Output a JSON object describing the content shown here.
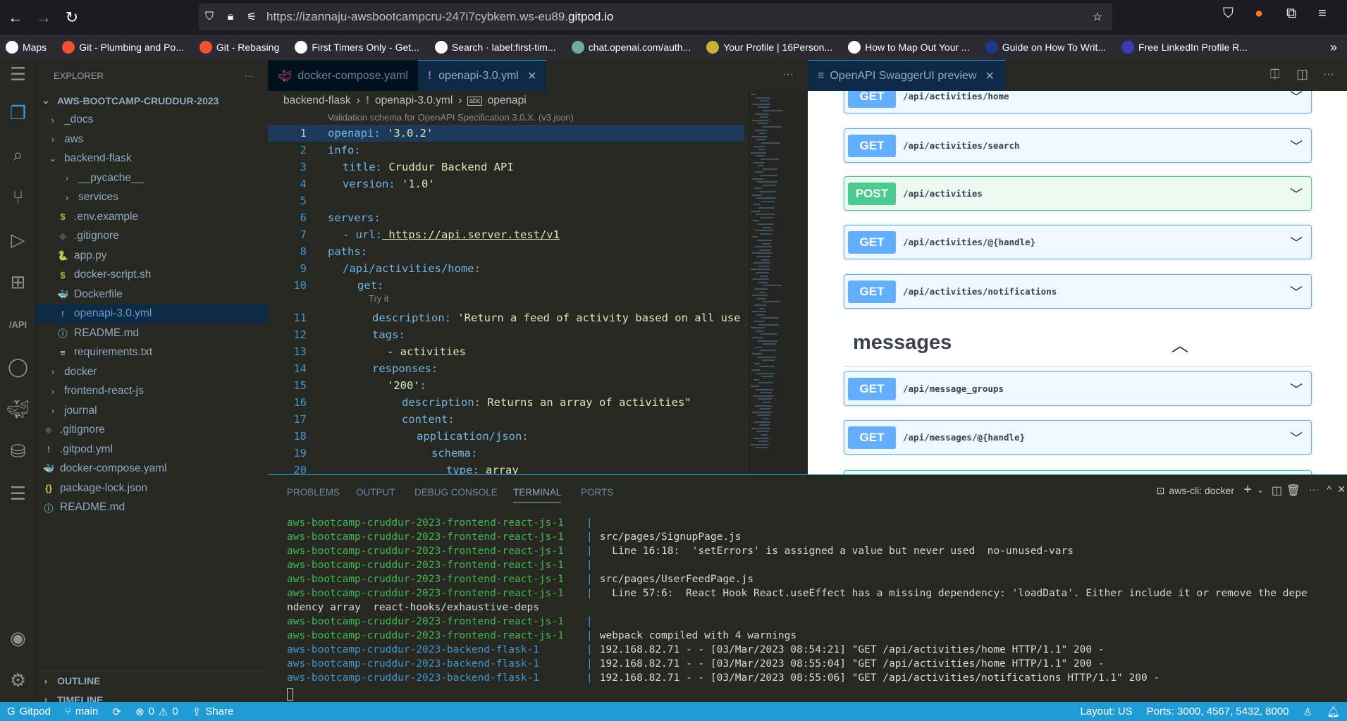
{
  "browser": {
    "url_prefix": "https://izannaju-awsbootcampcru-247i7cybkem.ws-eu89.",
    "url_domain": "gitpod.io",
    "bookmarks": [
      {
        "label": "Maps",
        "color": "#fbfbfe"
      },
      {
        "label": "Git - Plumbing and Po...",
        "color": "#f05133"
      },
      {
        "label": "Git - Rebasing",
        "color": "#f05133"
      },
      {
        "label": "First Timers Only - Get...",
        "color": "#fbfbfe"
      },
      {
        "label": "Search · label:first-tim...",
        "color": "#fbfbfe"
      },
      {
        "label": "chat.openai.com/auth...",
        "color": "#74aa9c"
      },
      {
        "label": "Your Profile | 16Person...",
        "color": "#c9b037"
      },
      {
        "label": "How to Map Out Your ...",
        "color": "#fbfbfe"
      },
      {
        "label": "Guide on How To Writ...",
        "color": "#1a3a8a"
      },
      {
        "label": "Free LinkedIn Profile R...",
        "color": "#3b3bb5"
      }
    ]
  },
  "sidebar": {
    "title": "EXPLORER",
    "root": "AWS-BOOTCAMP-CRUDDUR-2023",
    "items": [
      {
        "label": "_docs",
        "type": "folder",
        "depth": 1
      },
      {
        "label": "aws",
        "type": "folder",
        "depth": 1
      },
      {
        "label": "backend-flask",
        "type": "folder-open",
        "depth": 1
      },
      {
        "label": "__pycache__",
        "type": "folder",
        "depth": 2
      },
      {
        "label": "services",
        "type": "folder",
        "depth": 2
      },
      {
        "label": ".env.example",
        "type": "file",
        "icon": "$",
        "iconColor": "#8dc149",
        "depth": 2
      },
      {
        "label": ".gitignore",
        "type": "file",
        "icon": "◆",
        "iconColor": "#41535b",
        "depth": 2
      },
      {
        "label": "app.py",
        "type": "file",
        "icon": "🐍",
        "iconColor": "#3e97d1",
        "depth": 2
      },
      {
        "label": "docker-script.sh",
        "type": "file",
        "icon": "$",
        "iconColor": "#8dc149",
        "depth": 2
      },
      {
        "label": "Dockerfile",
        "type": "file",
        "icon": "🐳",
        "iconColor": "#3e97d1",
        "depth": 2
      },
      {
        "label": "openapi-3.0.yml",
        "type": "file",
        "icon": "!",
        "iconColor": "#a074c4",
        "depth": 2,
        "selected": true
      },
      {
        "label": "README.md",
        "type": "file",
        "icon": "ⓘ",
        "iconColor": "#519aba",
        "depth": 2
      },
      {
        "label": "requirements.txt",
        "type": "file",
        "icon": "≡",
        "iconColor": "#d4d7d6",
        "depth": 2
      },
      {
        "label": "docker",
        "type": "folder",
        "depth": 1
      },
      {
        "label": "frontend-react-js",
        "type": "folder",
        "depth": 1
      },
      {
        "label": "journal",
        "type": "folder",
        "depth": 1
      },
      {
        "label": ".gitignore",
        "type": "file",
        "icon": "◆",
        "iconColor": "#41535b",
        "depth": 1
      },
      {
        "label": ".gitpod.yml",
        "type": "file",
        "icon": "!",
        "iconColor": "#a074c4",
        "depth": 1
      },
      {
        "label": "docker-compose.yaml",
        "type": "file",
        "icon": "🐳",
        "iconColor": "#e0487a",
        "depth": 1
      },
      {
        "label": "package-lock.json",
        "type": "file",
        "icon": "{}",
        "iconColor": "#cbcb41",
        "depth": 1
      },
      {
        "label": "README.md",
        "type": "file",
        "icon": "ⓘ",
        "iconColor": "#519aba",
        "depth": 1
      }
    ],
    "outline": "OUTLINE",
    "timeline": "TIMELINE"
  },
  "editor": {
    "tabs": [
      {
        "label": "docker-compose.yaml",
        "active": false
      },
      {
        "label": "openapi-3.0.yml",
        "active": true
      }
    ],
    "breadcrumbs": [
      "backend-flask",
      "openapi-3.0.yml",
      "openapi"
    ],
    "codelens_schema": "Validation schema for OpenAPI Specification 3.0.X. (v3.json)",
    "codelens_try": "Try it",
    "lines": [
      {
        "n": "1",
        "key": "openapi",
        "val": " '3.0.2'",
        "indent": 0
      },
      {
        "n": "2",
        "key": "info",
        "val": "",
        "indent": 0
      },
      {
        "n": "3",
        "key": "title",
        "val": " Cruddur Backend API",
        "indent": 1
      },
      {
        "n": "4",
        "key": "version",
        "val": " '1.0'",
        "indent": 1
      },
      {
        "n": "5",
        "key": "",
        "val": "",
        "indent": 0
      },
      {
        "n": "6",
        "key": "servers",
        "val": "",
        "indent": 0
      },
      {
        "n": "7",
        "key": "- url",
        "val": " https://api.server.test/v1",
        "indent": 1
      },
      {
        "n": "8",
        "key": "paths",
        "val": "",
        "indent": 0
      },
      {
        "n": "9",
        "key": "/api/activities/home",
        "val": "",
        "indent": 1
      },
      {
        "n": "10",
        "key": "get",
        "val": "",
        "indent": 2
      },
      {
        "n": "11",
        "key": "description",
        "val": " 'Return a feed of activity based on all use",
        "indent": 3
      },
      {
        "n": "12",
        "key": "tags",
        "val": "",
        "indent": 3
      },
      {
        "n": "13",
        "key": "- activities",
        "val": "",
        "indent": 4
      },
      {
        "n": "14",
        "key": "responses",
        "val": "",
        "indent": 3
      },
      {
        "n": "15",
        "key": "'200'",
        "val": "",
        "indent": 4
      },
      {
        "n": "16",
        "key": "description",
        "val": " Returns an array of activities\"",
        "indent": 5
      },
      {
        "n": "17",
        "key": "content",
        "val": "",
        "indent": 5
      },
      {
        "n": "18",
        "key": "application/json",
        "val": "",
        "indent": 6
      },
      {
        "n": "19",
        "key": "schema",
        "val": "",
        "indent": 7
      },
      {
        "n": "20",
        "key": "type",
        "val": " array",
        "indent": 8
      }
    ]
  },
  "preview": {
    "tab_label": "OpenAPI SwaggerUI preview",
    "section_messages": "messages",
    "operations": [
      {
        "method": "GET",
        "path": "/api/activities/home"
      },
      {
        "method": "GET",
        "path": "/api/activities/search"
      },
      {
        "method": "POST",
        "path": "/api/activities"
      },
      {
        "method": "GET",
        "path": "/api/activities/@{handle}"
      },
      {
        "method": "GET",
        "path": "/api/activities/notifications"
      },
      {
        "method": "GET",
        "path": "/api/message_groups"
      },
      {
        "method": "GET",
        "path": "/api/messages/@{handle}"
      }
    ]
  },
  "panel": {
    "tabs": [
      "PROBLEMS",
      "OUTPUT",
      "DEBUG CONSOLE",
      "TERMINAL",
      "PORTS"
    ],
    "active_tab": "TERMINAL",
    "terminal_name": "aws-cli: docker",
    "lines": [
      {
        "prefix": "aws-bootcamp-cruddur-2023-frontend-react-js-1",
        "color": "#3fb950",
        "msg": ""
      },
      {
        "prefix": "aws-bootcamp-cruddur-2023-frontend-react-js-1",
        "color": "#3fb950",
        "msg": "src/pages/SignupPage.js"
      },
      {
        "prefix": "aws-bootcamp-cruddur-2023-frontend-react-js-1",
        "color": "#3fb950",
        "msg": "  Line 16:18:  'setErrors' is assigned a value but never used  no-unused-vars"
      },
      {
        "prefix": "aws-bootcamp-cruddur-2023-frontend-react-js-1",
        "color": "#3fb950",
        "msg": ""
      },
      {
        "prefix": "aws-bootcamp-cruddur-2023-frontend-react-js-1",
        "color": "#3fb950",
        "msg": "src/pages/UserFeedPage.js"
      },
      {
        "prefix": "aws-bootcamp-cruddur-2023-frontend-react-js-1",
        "color": "#3fb950",
        "msg": "  Line 57:6:  React Hook React.useEffect has a missing dependency: 'loadData'. Either include it or remove the depe"
      },
      {
        "prefix": "",
        "color": "#d8d8d8",
        "msg": "ndency array  react-hooks/exhaustive-deps",
        "wrap": true
      },
      {
        "prefix": "aws-bootcamp-cruddur-2023-frontend-react-js-1",
        "color": "#3fb950",
        "msg": ""
      },
      {
        "prefix": "aws-bootcamp-cruddur-2023-frontend-react-js-1",
        "color": "#3fb950",
        "msg": "webpack compiled with 4 warnings"
      },
      {
        "prefix": "aws-bootcamp-cruddur-2023-backend-flask-1",
        "color": "#3e97d1",
        "msg": "192.168.82.71 - - [03/Mar/2023 08:54:21] \"GET /api/activities/home HTTP/1.1\" 200 -"
      },
      {
        "prefix": "aws-bootcamp-cruddur-2023-backend-flask-1",
        "color": "#3e97d1",
        "msg": "192.168.82.71 - - [03/Mar/2023 08:55:04] \"GET /api/activities/home HTTP/1.1\" 200 -"
      },
      {
        "prefix": "aws-bootcamp-cruddur-2023-backend-flask-1",
        "color": "#3e97d1",
        "msg": "192.168.82.71 - - [03/Mar/2023 08:55:06] \"GET /api/activities/notifications HTTP/1.1\" 200 -"
      }
    ]
  },
  "status": {
    "gitpod": "Gitpod",
    "branch": "main",
    "errors": "0",
    "warnings": "0",
    "share": "Share",
    "layout": "Layout: US",
    "ports": "Ports: 3000, 4567, 5432, 8000"
  }
}
